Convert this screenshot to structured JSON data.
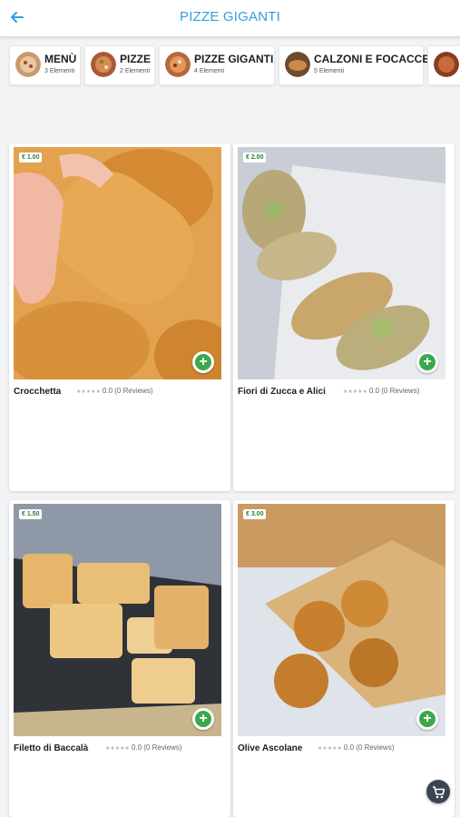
{
  "header": {
    "title": "PIZZE GIGANTI",
    "back_icon": "arrow-left-icon",
    "accent": "#2f9fe0"
  },
  "categories": [
    {
      "title": "MENÙ",
      "count": "3 Elementi"
    },
    {
      "title": "PIZZE",
      "count": "2 Elementi"
    },
    {
      "title": "PIZZE GIGANTI",
      "count": "4 Elementi"
    },
    {
      "title": "CALZONI E FOCACCE",
      "count": "5 Elementi"
    },
    {
      "title": "",
      "count": ""
    }
  ],
  "products": [
    {
      "price": "€ 1.00",
      "name": "Crocchetta",
      "rating": "0.0 (0 Reviews)"
    },
    {
      "price": "€ 2.00",
      "name": "Fiori di Zucca e Alici",
      "rating": "0.0 (0 Reviews)"
    },
    {
      "price": "€ 1.50",
      "name": "Filetto di Baccalà",
      "rating": "0.0 (0 Reviews)"
    },
    {
      "price": "€ 3.00",
      "name": "Olive Ascolane",
      "rating": "0.0 (0 Reviews)"
    }
  ],
  "stars": "★★★★★",
  "cart_icon": "cart-icon",
  "add_icon": "plus-icon",
  "status_green": "#3aa94b"
}
